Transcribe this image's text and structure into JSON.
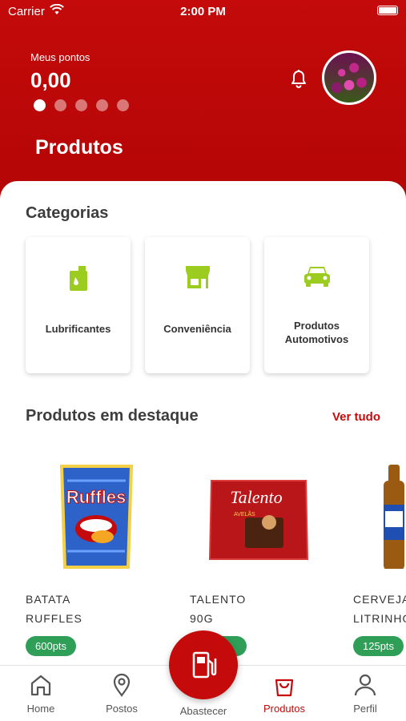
{
  "status_bar": {
    "carrier": "Carrier",
    "time": "2:00 PM"
  },
  "header": {
    "points_label": "Meus pontos",
    "points_value": "0,00",
    "carousel_dots": 5,
    "active_dot": 0,
    "title": "Produtos"
  },
  "categories": {
    "title": "Categorias",
    "items": [
      {
        "label": "Lubrificantes",
        "icon": "oil-can-icon"
      },
      {
        "label": "Conveniência",
        "icon": "store-icon"
      },
      {
        "label": "Produtos Automotivos",
        "icon": "car-icon"
      }
    ]
  },
  "featured": {
    "title": "Produtos em destaque",
    "see_all": "Ver tudo",
    "items": [
      {
        "name_line1": "BATATA",
        "name_line2": "RUFFLES",
        "price": "600pts"
      },
      {
        "name_line1": "TALENTO",
        "name_line2": "90G",
        "price": ""
      },
      {
        "name_line1": "CERVEJA",
        "name_line2": "LITRINHO",
        "price": "125pts"
      }
    ]
  },
  "product_art": {
    "ruffles_logo": "Ruffles",
    "talento_logo": "Talento",
    "talento_flavor": "AVELÃS"
  },
  "bottom_nav": {
    "home": "Home",
    "postos": "Postos",
    "abastecer": "Abastecer",
    "produtos": "Produtos",
    "perfil": "Perfil"
  },
  "colors": {
    "brand_red": "#c40a0a",
    "icon_green": "#9ccc1f",
    "price_green": "#2f9e57"
  }
}
